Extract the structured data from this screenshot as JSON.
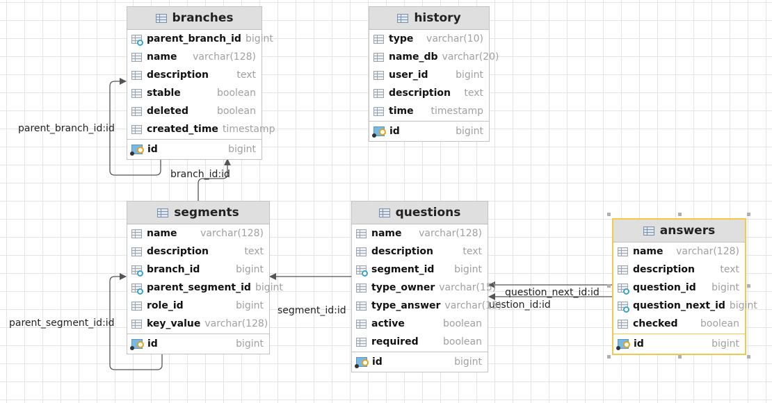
{
  "tables": {
    "branches": {
      "name": "branches",
      "columns": [
        {
          "name": "parent_branch_id",
          "type": "bigint",
          "icon": "foreign-key-icon"
        },
        {
          "name": "name",
          "type": "varchar(128)",
          "icon": "column-icon"
        },
        {
          "name": "description",
          "type": "text",
          "icon": "column-icon"
        },
        {
          "name": "stable",
          "type": "boolean",
          "icon": "column-icon"
        },
        {
          "name": "deleted",
          "type": "boolean",
          "icon": "column-icon"
        },
        {
          "name": "created_time",
          "type": "timestamp",
          "icon": "column-icon"
        }
      ],
      "pk": {
        "name": "id",
        "type": "bigint",
        "icon": "primary-key-icon"
      }
    },
    "history": {
      "name": "history",
      "columns": [
        {
          "name": "type",
          "type": "varchar(10)",
          "icon": "column-icon"
        },
        {
          "name": "name_db",
          "type": "varchar(20)",
          "icon": "column-icon"
        },
        {
          "name": "user_id",
          "type": "bigint",
          "icon": "column-icon"
        },
        {
          "name": "description",
          "type": "text",
          "icon": "column-icon"
        },
        {
          "name": "time",
          "type": "timestamp",
          "icon": "column-icon"
        }
      ],
      "pk": {
        "name": "id",
        "type": "bigint",
        "icon": "primary-key-icon"
      }
    },
    "segments": {
      "name": "segments",
      "columns": [
        {
          "name": "name",
          "type": "varchar(128)",
          "icon": "column-icon"
        },
        {
          "name": "description",
          "type": "text",
          "icon": "column-icon"
        },
        {
          "name": "branch_id",
          "type": "bigint",
          "icon": "foreign-key-icon"
        },
        {
          "name": "parent_segment_id",
          "type": "bigint",
          "icon": "foreign-key-icon"
        },
        {
          "name": "role_id",
          "type": "bigint",
          "icon": "column-icon"
        },
        {
          "name": "key_value",
          "type": "varchar(128)",
          "icon": "column-icon"
        }
      ],
      "pk": {
        "name": "id",
        "type": "bigint",
        "icon": "primary-key-icon"
      }
    },
    "questions": {
      "name": "questions",
      "columns": [
        {
          "name": "name",
          "type": "varchar(128)",
          "icon": "column-icon"
        },
        {
          "name": "description",
          "type": "text",
          "icon": "column-icon"
        },
        {
          "name": "segment_id",
          "type": "bigint",
          "icon": "foreign-key-icon"
        },
        {
          "name": "type_owner",
          "type": "varchar(15)",
          "icon": "column-icon"
        },
        {
          "name": "type_answer",
          "type": "varchar(15)",
          "icon": "column-icon"
        },
        {
          "name": "active",
          "type": "boolean",
          "icon": "column-icon"
        },
        {
          "name": "required",
          "type": "boolean",
          "icon": "column-icon"
        }
      ],
      "pk": {
        "name": "id",
        "type": "bigint",
        "icon": "primary-key-icon"
      }
    },
    "answers": {
      "name": "answers",
      "columns": [
        {
          "name": "name",
          "type": "varchar(128)",
          "icon": "column-icon"
        },
        {
          "name": "description",
          "type": "text",
          "icon": "column-icon"
        },
        {
          "name": "question_id",
          "type": "bigint",
          "icon": "foreign-key-icon"
        },
        {
          "name": "question_next_id",
          "type": "bigint",
          "icon": "foreign-key-icon"
        },
        {
          "name": "checked",
          "type": "boolean",
          "icon": "column-icon"
        }
      ],
      "pk": {
        "name": "id",
        "type": "bigint",
        "icon": "primary-key-icon"
      }
    }
  },
  "relations": {
    "parent_branch": "parent_branch_id:id",
    "branch": "branch_id:id",
    "parent_segment": "parent_segment_id:id",
    "segment": "segment_id:id",
    "question_next": "question_next_id:id",
    "question": "question_id:id"
  },
  "colors": {
    "selected_border": "#f2c94c",
    "header_bg": "#dfdfdf",
    "line": "#555555"
  }
}
